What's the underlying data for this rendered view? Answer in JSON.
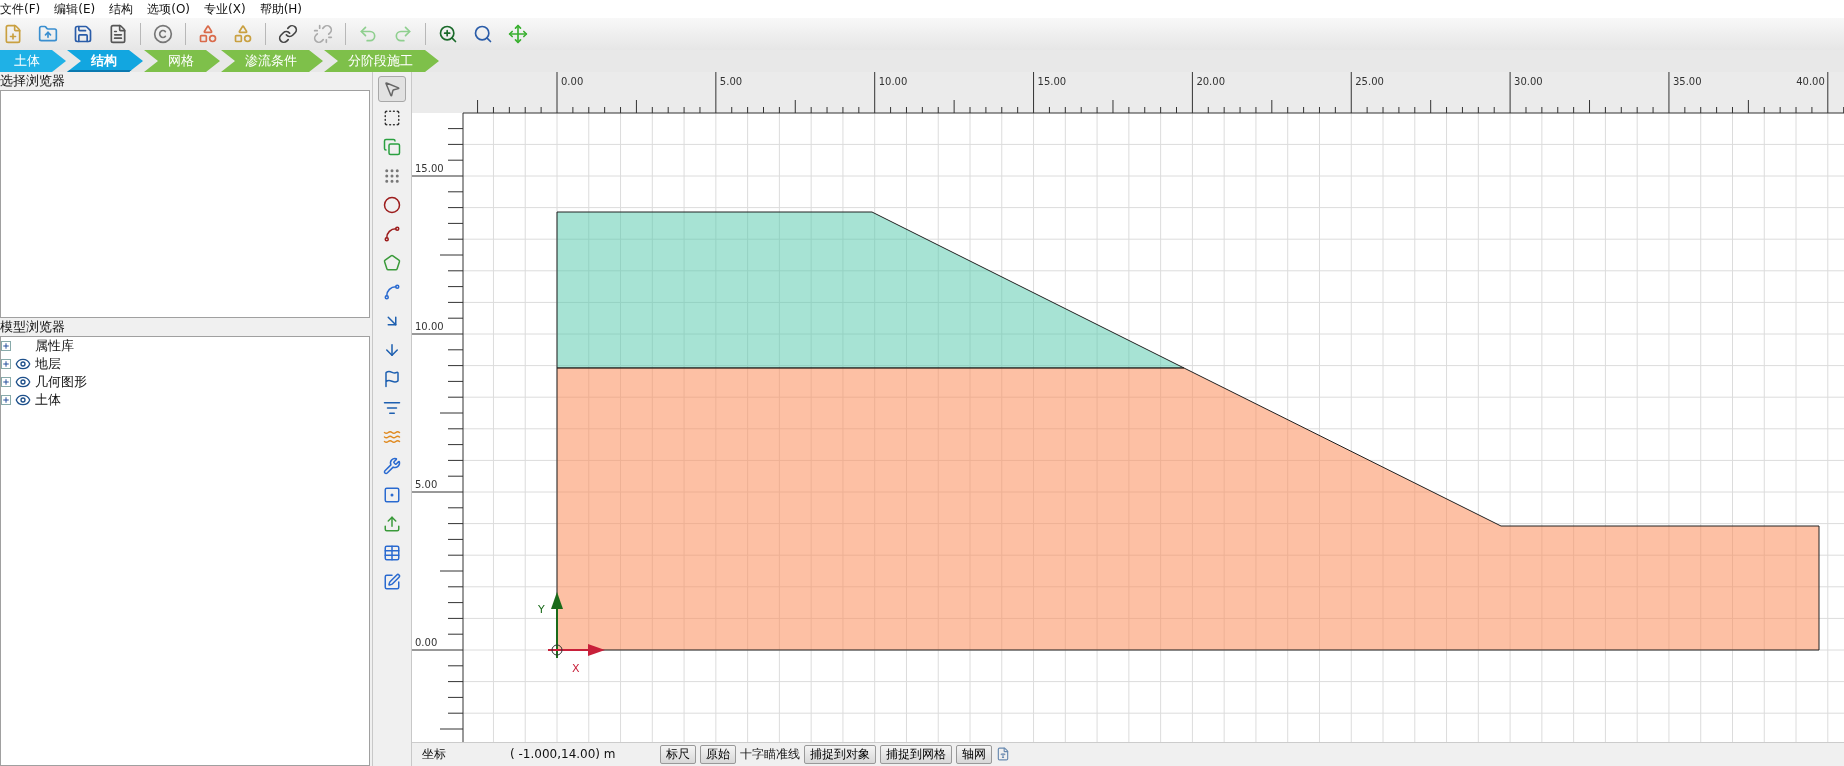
{
  "menu": [
    "文件(F)",
    "编辑(E)",
    "结构",
    "选项(O)",
    "专业(X)",
    "帮助(H)"
  ],
  "workflow_tabs": [
    {
      "label": "土体",
      "kind": "completed",
      "selected": false
    },
    {
      "label": "结构",
      "kind": "completed",
      "selected": true
    },
    {
      "label": "网格",
      "kind": "upcoming",
      "selected": false
    },
    {
      "label": "渗流条件",
      "kind": "upcoming",
      "selected": false
    },
    {
      "label": "分阶段施工",
      "kind": "upcoming",
      "selected": false
    }
  ],
  "selection_browser": {
    "title": "选择浏览器"
  },
  "model_browser": {
    "title": "模型浏览器",
    "items": [
      {
        "label": "属性库",
        "kind": "folder",
        "expanded": false
      },
      {
        "label": "地层",
        "kind": "visible",
        "expanded": false
      },
      {
        "label": "几何图形",
        "kind": "visible",
        "expanded": false
      },
      {
        "label": "土体",
        "kind": "visible",
        "expanded": false
      }
    ]
  },
  "canvas": {
    "x_ruler": [
      "0.00",
      "5.00",
      "10.00",
      "15.00",
      "20.00",
      "25.00",
      "30.00",
      "35.00",
      "40.00"
    ],
    "y_ruler": [
      "15.00",
      "10.00",
      "5.00",
      "0.00"
    ],
    "x_axis_label": "X",
    "y_axis_label": "Y"
  },
  "status_bar": {
    "coord_label": "坐标",
    "coord_value": "( -1.000,14.00) m",
    "toggles": [
      {
        "label": "标尺",
        "kind": "button"
      },
      {
        "label": "原始",
        "kind": "button"
      },
      {
        "label": "十字瞄准线",
        "kind": "text"
      },
      {
        "label": "捕捉到对象",
        "kind": "button"
      },
      {
        "label": "捕捉到网格",
        "kind": "button"
      },
      {
        "label": "轴网",
        "kind": "button"
      }
    ]
  }
}
